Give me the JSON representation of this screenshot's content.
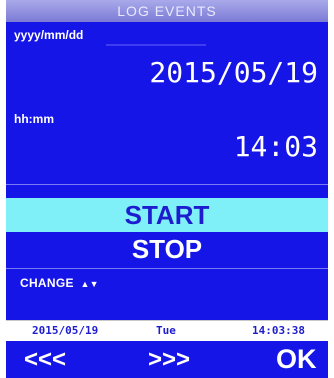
{
  "header": {
    "title": "LOG EVENTS"
  },
  "date": {
    "label": "yyyy/mm/dd",
    "value": "2015/05/19"
  },
  "time": {
    "label": "hh:mm",
    "value": "14:03"
  },
  "options": [
    {
      "label": "START",
      "selected": true
    },
    {
      "label": "STOP",
      "selected": false
    }
  ],
  "change": {
    "label": "CHANGE",
    "icon": "up-down-arrows-icon",
    "glyph": "▲▼"
  },
  "status_bar": {
    "date": "2015/05/19",
    "day": "Tue",
    "time": "14:03:38"
  },
  "nav": {
    "back_label": "<<<",
    "forward_label": ">>>",
    "ok_label": "OK"
  },
  "colors": {
    "background": "#1515e8",
    "highlight": "#7ff0f8",
    "header": "#a9a9ea"
  }
}
